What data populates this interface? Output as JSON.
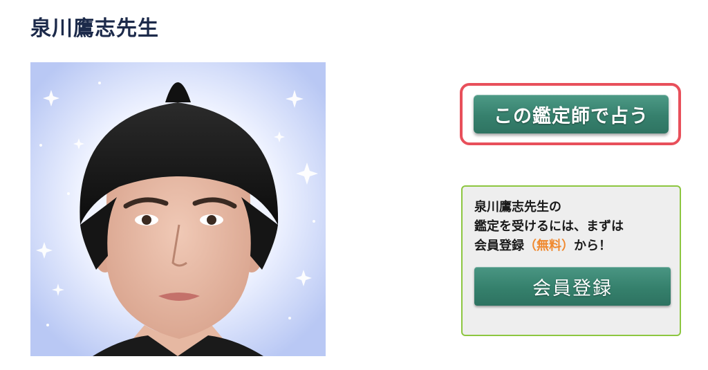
{
  "profile": {
    "name": "泉川鷹志先生"
  },
  "photo": {
    "icon": "fortune-teller-portrait",
    "background_color": "#c6d3f6",
    "glow_color": "#ffffff"
  },
  "cta": {
    "label": "この鑑定師で占う",
    "frame_color": "#e8505b",
    "button_color": "#36806d"
  },
  "register": {
    "line1": "泉川鷹志先生の",
    "line2": "鑑定を受けるには、まずは",
    "line3_prefix": "会員登録",
    "line3_free": "（無料）",
    "line3_suffix": "から！",
    "button_label": "会員登録",
    "border_color": "#8cc63f",
    "free_color": "#f0892f"
  }
}
